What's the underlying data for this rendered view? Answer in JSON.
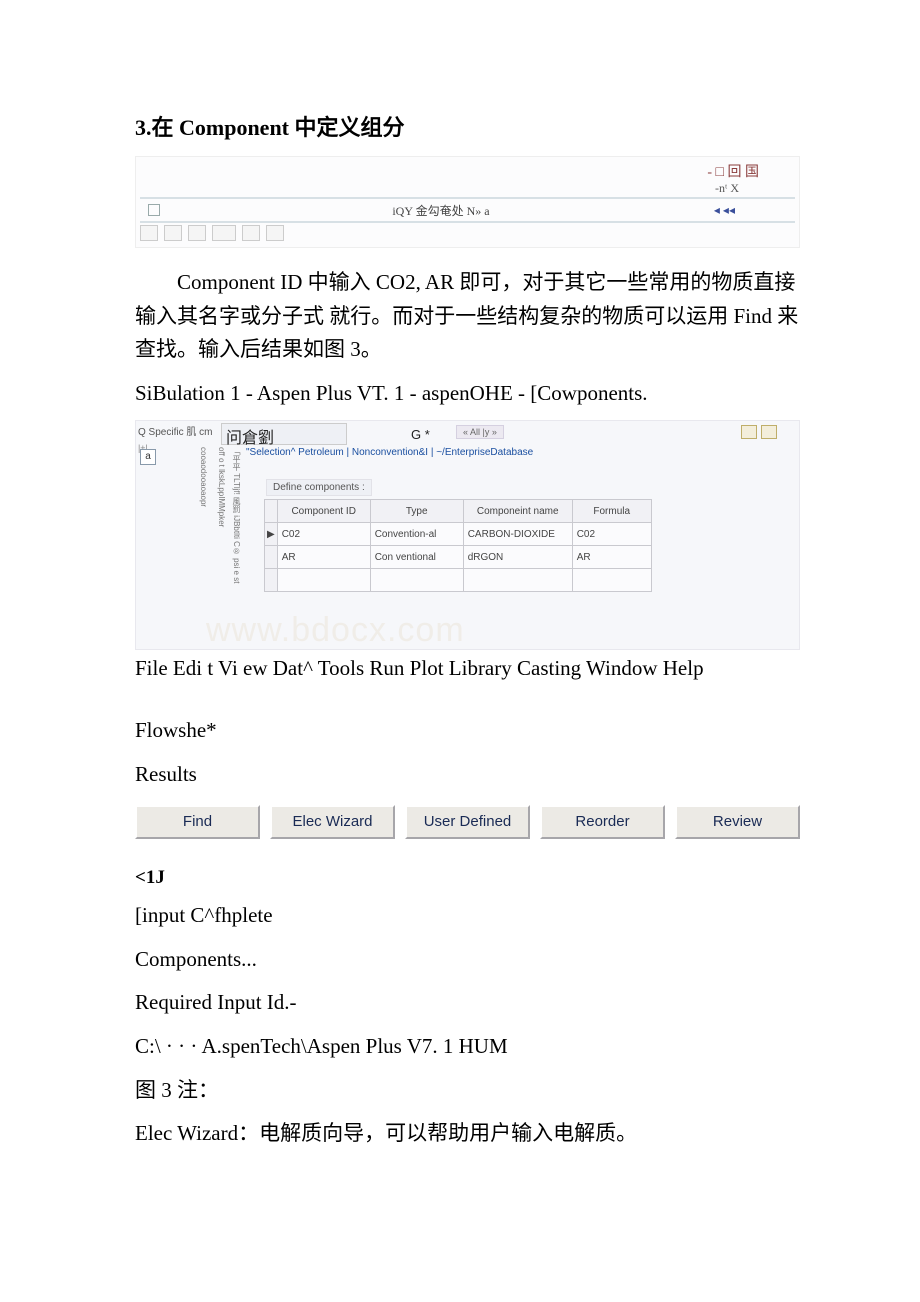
{
  "heading": "3.在 Component 中定义组分",
  "fig1": {
    "top_right": "- □ 回 国",
    "nx": "-nᵗ X",
    "row1_center": "iQY 金勾奄处  N» a",
    "row1_right": "◂  ◂◂"
  },
  "para1": "Component ID 中输入 CO2, AR 即可，对于其它一些常用的物质直接输入其名字或分子式 就行。而对于一些结构复杂的物质可以运用 Find 来查找。输入后结果如图 3。",
  "sim_title": "SiBulation 1 - Aspen Plus VT. 1 - aspenOHE - [Cowponents.",
  "fig2": {
    "specific": "Q Specific 肌 cm",
    "a": "a",
    "vert1": "cooaodooaoaopr",
    "vert2": "off o t lkskLppIMMpker",
    "vert3": "「平平 TLTljf! 風罰 iJBbtlti C® psi e st",
    "title_box": "问倉劉",
    "g_star": "G  *",
    "ally": "« All |y »",
    "tabs_html": "\"Selection^ Petroleum | Nonconvention&I | ~/EnterpriseDatabase",
    "define": "Define components :",
    "th1": "Component ID",
    "th2": "Type",
    "th3": "Componeint name",
    "th4": "Formula",
    "r1c1": "C02",
    "r1c2": "Convention-al",
    "r1c3": "CARBON-DIOXIDE",
    "r1c4": "C02",
    "r2c1": "AR",
    "r2c2": "Con ventional",
    "r2c3": "dRGON",
    "r2c4": "AR",
    "watermark": "www.bdocx.com"
  },
  "menu_line": "File Edi t Vi ew Dat^ Tools Run Plot Library Casting Window Help",
  "flowshe": "Flowshe*",
  "results": "Results",
  "buttons": {
    "find": "Find",
    "elec": "Elec Wizard",
    "user": "User Defined",
    "reorder": "Reorder",
    "review": "Review"
  },
  "lt1j": "<1J",
  "input_complete": "[input C^fhplete",
  "components_dots": "Components...",
  "required_input": "Required Input Id.-",
  "path": "C:\\ · · ·   A.spenTech\\Aspen Plus V7. 1 HUM",
  "fig3_note": "图 3 注：",
  "elec_desc": "Elec Wizard：电解质向导，可以帮助用户输入电解质。"
}
